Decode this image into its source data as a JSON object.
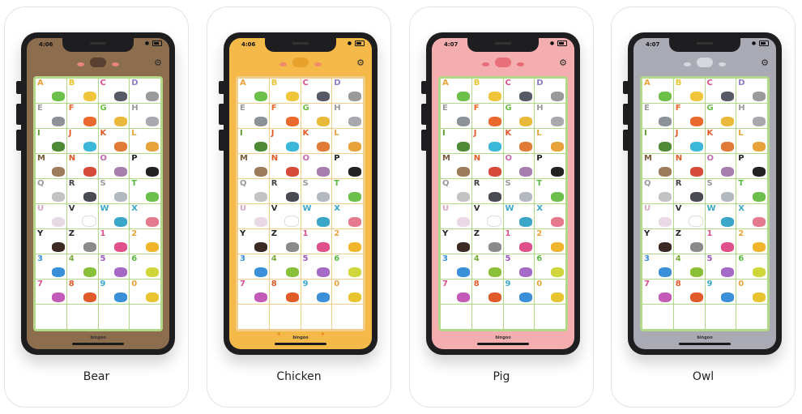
{
  "tiles": [
    {
      "label": "A",
      "color": "#e8a23a",
      "pic": "#6cc04a"
    },
    {
      "label": "B",
      "color": "#e8c530",
      "pic": "#f0c53a"
    },
    {
      "label": "C",
      "color": "#d9508f",
      "pic": "#555a66"
    },
    {
      "label": "D",
      "color": "#8e7cc3",
      "pic": "#9a9a9a"
    },
    {
      "label": "E",
      "color": "#9a9a9a",
      "pic": "#8d9299"
    },
    {
      "label": "F",
      "color": "#e96a2c",
      "pic": "#e96a2c"
    },
    {
      "label": "G",
      "color": "#6cbf44",
      "pic": "#e8b93a"
    },
    {
      "label": "H",
      "color": "#9a9a9a",
      "pic": "#a8a8ae"
    },
    {
      "label": "I",
      "color": "#5c9a32",
      "pic": "#4e8a35"
    },
    {
      "label": "J",
      "color": "#e05a2a",
      "pic": "#3ab7d9"
    },
    {
      "label": "K",
      "color": "#e05a2a",
      "pic": "#e07a36"
    },
    {
      "label": "L",
      "color": "#e8a23a",
      "pic": "#e8a23a"
    },
    {
      "label": "M",
      "color": "#7a5a3a",
      "pic": "#9b7b5a"
    },
    {
      "label": "N",
      "color": "#e05a2a",
      "pic": "#d64a3a"
    },
    {
      "label": "O",
      "color": "#c56bb0",
      "pic": "#a77fae"
    },
    {
      "label": "P",
      "color": "#222222",
      "pic": "#222222"
    },
    {
      "label": "Q",
      "color": "#9a9a9a",
      "pic": "#c3c3c3"
    },
    {
      "label": "R",
      "color": "#444444",
      "pic": "#4a4a52"
    },
    {
      "label": "S",
      "color": "#9a9a9a",
      "pic": "#b4b9bf"
    },
    {
      "label": "T",
      "color": "#5cb944",
      "pic": "#6bbf4a"
    },
    {
      "label": "U",
      "color": "#d9a7c7",
      "pic": "#e9d9e4"
    },
    {
      "label": "V",
      "color": "#333333",
      "pic": "#ffffff"
    },
    {
      "label": "W",
      "color": "#3aa7c8",
      "pic": "#3aa7c8"
    },
    {
      "label": "X",
      "color": "#3aa7c8",
      "pic": "#e57a8f"
    },
    {
      "label": "Y",
      "color": "#222222",
      "pic": "#3a2a22"
    },
    {
      "label": "Z",
      "color": "#222222",
      "pic": "#8a8a8a"
    },
    {
      "label": "1",
      "color": "#d9508f",
      "pic": "#e0508a"
    },
    {
      "label": "2",
      "color": "#e8a23a",
      "pic": "#f0b52a"
    },
    {
      "label": "3",
      "color": "#3a8fd9",
      "pic": "#3a8fd9"
    },
    {
      "label": "4",
      "color": "#7aa83a",
      "pic": "#8abf3a"
    },
    {
      "label": "5",
      "color": "#9b5ab8",
      "pic": "#a46ac5"
    },
    {
      "label": "6",
      "color": "#5cb944",
      "pic": "#cfd63a"
    },
    {
      "label": "7",
      "color": "#d9508f",
      "pic": "#c45ab8"
    },
    {
      "label": "8",
      "color": "#e05a2a",
      "pic": "#e05a2a"
    },
    {
      "label": "9",
      "color": "#3aa7c8",
      "pic": "#3a8fd9"
    },
    {
      "label": "0",
      "color": "#e8a23a",
      "pic": "#e8c530"
    },
    {
      "label": "",
      "color": "#ffffff",
      "pic": "#ffffff"
    },
    {
      "label": "",
      "color": "#ffffff",
      "pic": "#ffffff"
    },
    {
      "label": "",
      "color": "#ffffff",
      "pic": "#ffffff"
    },
    {
      "label": "",
      "color": "#ffffff",
      "pic": "#ffffff"
    }
  ],
  "cards": [
    {
      "caption": "Bear",
      "time": "4:06",
      "screen_bg": "#8c6d4e",
      "board_bg": "#b4d889",
      "face": "#5a4030",
      "cheek": "#e6877a",
      "logo": "bingoo"
    },
    {
      "caption": "Chicken",
      "time": "4:06",
      "screen_bg": "#f5b94a",
      "board_bg": "#f0ce8e",
      "face": "#e8a12a",
      "cheek": "#ef8a6a",
      "logo": "bingoo"
    },
    {
      "caption": "Pig",
      "time": "4:07",
      "screen_bg": "#f5aeb0",
      "board_bg": "#b4d889",
      "face": "#e9707a",
      "cheek": "#e66b75",
      "logo": "bingoo"
    },
    {
      "caption": "Owl",
      "time": "4:07",
      "screen_bg": "#a9aab4",
      "board_bg": "#b4d889",
      "face": "#d6d8de",
      "cheek": "#d6d8de",
      "logo": "bingoo"
    }
  ]
}
